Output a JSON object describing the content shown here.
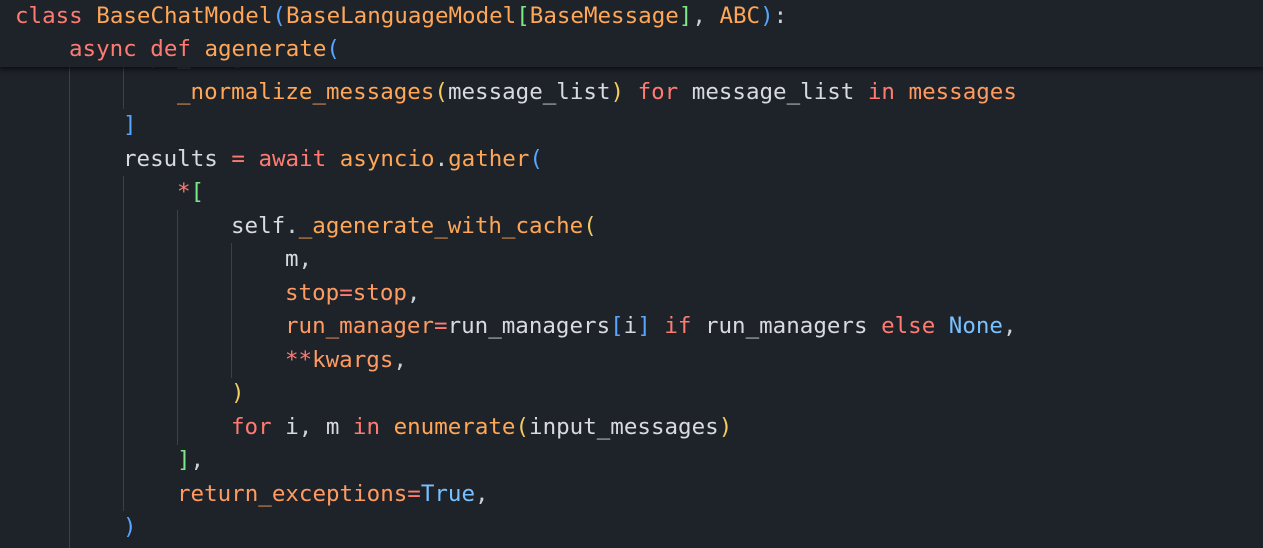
{
  "theme": {
    "background": "#1e2329",
    "indent_guide": "#3b414a"
  },
  "sticky": [
    {
      "tokens": [
        {
          "t": "class",
          "c": "kw"
        },
        {
          "t": " ",
          "c": "c"
        },
        {
          "t": "BaseChatModel",
          "c": "cls"
        },
        {
          "t": "(",
          "c": "b1"
        },
        {
          "t": "BaseLanguageModel",
          "c": "cls"
        },
        {
          "t": "[",
          "c": "b2"
        },
        {
          "t": "BaseMessage",
          "c": "cls"
        },
        {
          "t": "]",
          "c": "b2"
        },
        {
          "t": ", ",
          "c": "c"
        },
        {
          "t": "ABC",
          "c": "cls"
        },
        {
          "t": ")",
          "c": "b1"
        },
        {
          "t": ":",
          "c": "c"
        }
      ]
    },
    {
      "tokens": [
        {
          "t": "async",
          "c": "kw"
        },
        {
          "t": " ",
          "c": "c"
        },
        {
          "t": "def",
          "c": "kw"
        },
        {
          "t": " ",
          "c": "c"
        },
        {
          "t": "agenerate",
          "c": "fn"
        },
        {
          "t": "(",
          "c": "b1"
        }
      ]
    }
  ],
  "code": [
    {
      "tokens": [
        {
          "t": "_normalize_messages",
          "c": "fn"
        },
        {
          "t": "(",
          "c": "b3"
        },
        {
          "t": "message_list",
          "c": "id"
        },
        {
          "t": ")",
          "c": "b3"
        },
        {
          "t": " ",
          "c": "c"
        },
        {
          "t": "for",
          "c": "kw"
        },
        {
          "t": " ",
          "c": "c"
        },
        {
          "t": "message_list",
          "c": "id"
        },
        {
          "t": " ",
          "c": "c"
        },
        {
          "t": "in",
          "c": "kw"
        },
        {
          "t": " ",
          "c": "c"
        },
        {
          "t": "messages",
          "c": "ar"
        }
      ]
    },
    {
      "tokens": [
        {
          "t": "]",
          "c": "b1"
        }
      ]
    },
    {
      "tokens": [
        {
          "t": "results",
          "c": "id"
        },
        {
          "t": " ",
          "c": "c"
        },
        {
          "t": "=",
          "c": "op"
        },
        {
          "t": " ",
          "c": "c"
        },
        {
          "t": "await",
          "c": "kw"
        },
        {
          "t": " ",
          "c": "c"
        },
        {
          "t": "asyncio",
          "c": "fn"
        },
        {
          "t": ".",
          "c": "c"
        },
        {
          "t": "gather",
          "c": "fn"
        },
        {
          "t": "(",
          "c": "b1"
        }
      ]
    },
    {
      "tokens": [
        {
          "t": "*",
          "c": "op"
        },
        {
          "t": "[",
          "c": "b2"
        }
      ]
    },
    {
      "tokens": [
        {
          "t": "self",
          "c": "id"
        },
        {
          "t": ".",
          "c": "c"
        },
        {
          "t": "_agenerate_with_cache",
          "c": "fn"
        },
        {
          "t": "(",
          "c": "b3"
        }
      ]
    },
    {
      "tokens": [
        {
          "t": "m",
          "c": "id"
        },
        {
          "t": ",",
          "c": "c"
        }
      ]
    },
    {
      "tokens": [
        {
          "t": "stop",
          "c": "ar"
        },
        {
          "t": "=",
          "c": "op"
        },
        {
          "t": "stop",
          "c": "ar"
        },
        {
          "t": ",",
          "c": "c"
        }
      ]
    },
    {
      "tokens": [
        {
          "t": "run_manager",
          "c": "ar"
        },
        {
          "t": "=",
          "c": "op"
        },
        {
          "t": "run_managers",
          "c": "id"
        },
        {
          "t": "[",
          "c": "b1"
        },
        {
          "t": "i",
          "c": "id"
        },
        {
          "t": "]",
          "c": "b1"
        },
        {
          "t": " ",
          "c": "c"
        },
        {
          "t": "if",
          "c": "kw"
        },
        {
          "t": " ",
          "c": "c"
        },
        {
          "t": "run_managers",
          "c": "id"
        },
        {
          "t": " ",
          "c": "c"
        },
        {
          "t": "else",
          "c": "kw"
        },
        {
          "t": " ",
          "c": "c"
        },
        {
          "t": "None",
          "c": "bool"
        },
        {
          "t": ",",
          "c": "c"
        }
      ]
    },
    {
      "tokens": [
        {
          "t": "**",
          "c": "op"
        },
        {
          "t": "kwargs",
          "c": "ar"
        },
        {
          "t": ",",
          "c": "c"
        }
      ]
    },
    {
      "tokens": [
        {
          "t": ")",
          "c": "b3"
        }
      ]
    },
    {
      "tokens": [
        {
          "t": "for",
          "c": "kw"
        },
        {
          "t": " ",
          "c": "c"
        },
        {
          "t": "i",
          "c": "id"
        },
        {
          "t": ", ",
          "c": "c"
        },
        {
          "t": "m",
          "c": "id"
        },
        {
          "t": " ",
          "c": "c"
        },
        {
          "t": "in",
          "c": "kw"
        },
        {
          "t": " ",
          "c": "c"
        },
        {
          "t": "enumerate",
          "c": "fn"
        },
        {
          "t": "(",
          "c": "b3"
        },
        {
          "t": "input_messages",
          "c": "id"
        },
        {
          "t": ")",
          "c": "b3"
        }
      ]
    },
    {
      "tokens": [
        {
          "t": "]",
          "c": "b2"
        },
        {
          "t": ",",
          "c": "c"
        }
      ]
    },
    {
      "tokens": [
        {
          "t": "return_exceptions",
          "c": "ar"
        },
        {
          "t": "=",
          "c": "op"
        },
        {
          "t": "True",
          "c": "bool"
        },
        {
          "t": ",",
          "c": "c"
        }
      ]
    },
    {
      "tokens": [
        {
          "t": ")",
          "c": "b1"
        }
      ]
    }
  ]
}
